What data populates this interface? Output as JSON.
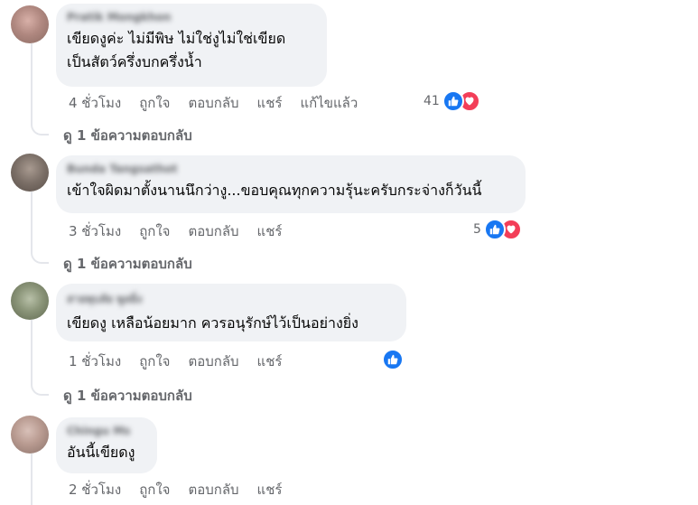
{
  "comments": [
    {
      "author": "Pratik Mongkhon",
      "text": "เขียดงูค่ะ ไม่มีพิษ ไม่ใช่งูไม่ใช่เขียด\nเป็นสัตว์ครึ่งบกครึ่งน้ำ",
      "time": "4 ชั่วโมง",
      "like": "ถูกใจ",
      "reply": "ตอบกลับ",
      "share": "แชร์",
      "edited": "แก้ไขแล้ว",
      "reaction_count": "41",
      "reactions": [
        "like-icon",
        "love-icon"
      ],
      "view_replies": "ดู 1 ข้อความตอบกลับ"
    },
    {
      "author": "Bunda Tangsathot",
      "text": "เข้าใจผิดมาตั้งนานนึกว่างู...ขอบคุณทุกความรุ้นะครับกระจ่างก็วันนี้",
      "time": "3 ชั่วโมง",
      "like": "ถูกใจ",
      "reply": "ตอบกลับ",
      "share": "แชร์",
      "reaction_count": "5",
      "reactions": [
        "like-icon",
        "love-icon"
      ],
      "view_replies": "ดู 1 ข้อความตอบกลับ"
    },
    {
      "author": "สายพุบลัย พูลยิ่ง",
      "text": "เขียดงู เหลือน้อยมาก ควรอนุรักษ์ไว้เป็นอย่างยิ่ง",
      "time": "1 ชั่วโมง",
      "like": "ถูกใจ",
      "reply": "ตอบกลับ",
      "share": "แชร์",
      "reactions": [
        "like-icon"
      ],
      "view_replies": "ดู 1 ข้อความตอบกลับ"
    },
    {
      "author": "Chingu Ms",
      "text": "อันนี้เขียดงู",
      "time": "2 ชั่วโมง",
      "like": "ถูกใจ",
      "reply": "ตอบกลับ",
      "share": "แชร์"
    }
  ],
  "colors": {
    "bubble": "#f0f2f5",
    "meta_text": "#65676b",
    "like_blue": "#1877f2",
    "love_red": "#f33e58"
  }
}
